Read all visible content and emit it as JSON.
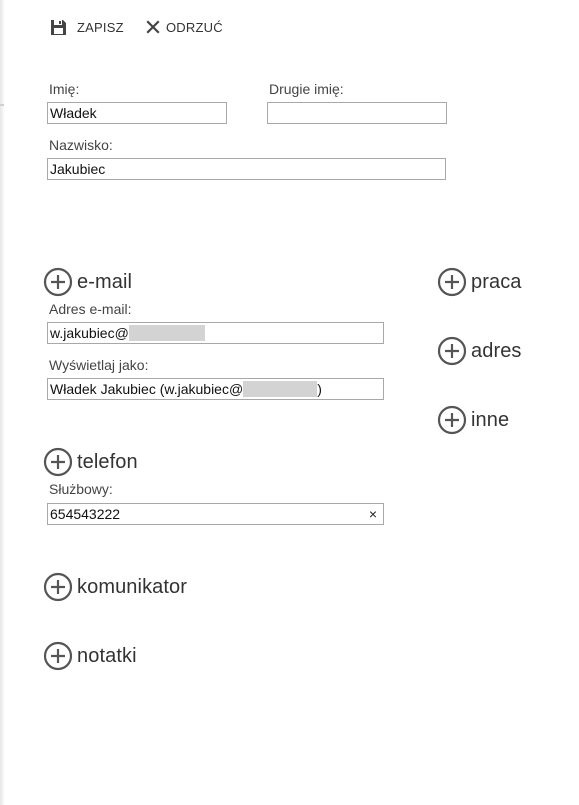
{
  "toolbar": {
    "save_label": "ZAPISZ",
    "discard_label": "ODRZUĆ"
  },
  "name": {
    "first_label": "Imię:",
    "first_value": "Władek",
    "middle_label": "Drugie imię:",
    "middle_value": "",
    "last_label": "Nazwisko:",
    "last_value": "Jakubiec"
  },
  "email": {
    "section_label": "e-mail",
    "address_label": "Adres e-mail:",
    "address_value": "w.jakubiec@",
    "display_label": "Wyświetlaj jako:",
    "display_value": "Władek Jakubiec (w.jakubiec@",
    "display_suffix": ")"
  },
  "phone": {
    "section_label": "telefon",
    "work_label": "Służbowy:",
    "work_value": "654543222",
    "clear_glyph": "×"
  },
  "sections": {
    "messenger": "komunikator",
    "notes": "notatki",
    "work": "praca",
    "address": "adres",
    "other": "inne"
  },
  "icons": {
    "save": "save-icon",
    "discard": "close-icon",
    "add": "plus-circle-icon"
  }
}
